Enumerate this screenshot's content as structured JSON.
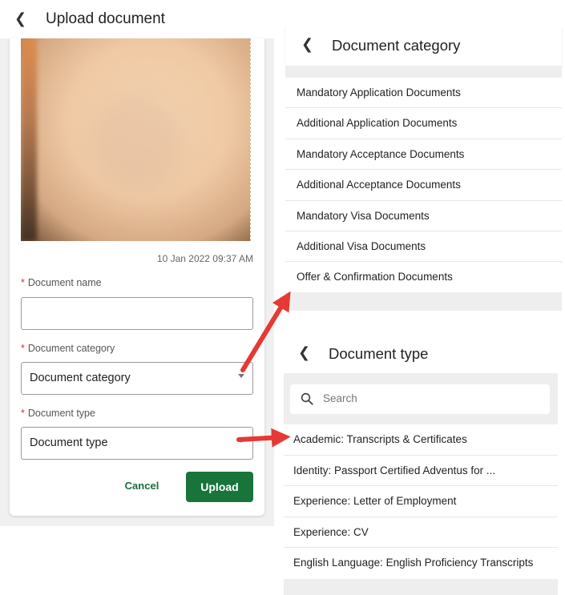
{
  "upload_screen": {
    "title": "Upload document",
    "timestamp": "10 Jan 2022 09:37 AM",
    "required_marker": "*",
    "fields": {
      "name_label": "Document name",
      "name_value": "",
      "category_label": "Document category",
      "category_value": "Document category",
      "type_label": "Document type",
      "type_value": "Document type"
    },
    "cancel_label": "Cancel",
    "upload_label": "Upload"
  },
  "category_screen": {
    "title": "Document category",
    "items": [
      "Mandatory Application Documents",
      "Additional Application Documents",
      "Mandatory Acceptance Documents",
      "Additional Acceptance Documents",
      "Mandatory Visa Documents",
      "Additional Visa Documents",
      "Offer & Confirmation Documents"
    ]
  },
  "type_screen": {
    "title": "Document type",
    "search_placeholder": "Search",
    "items": [
      "Academic: Transcripts & Certificates",
      "Identity: Passport Certified Adventus for ...",
      "Experience: Letter of Employment",
      "Experience: CV",
      "English Language: English Proficiency Transcripts"
    ]
  },
  "icons": {
    "back": "chevron-left-icon",
    "search": "search-icon",
    "dropdown": "caret-down-icon"
  },
  "colors": {
    "primary_green": "#18743b",
    "required_red": "#d32f2f",
    "annotation_arrow": "#e53935"
  }
}
